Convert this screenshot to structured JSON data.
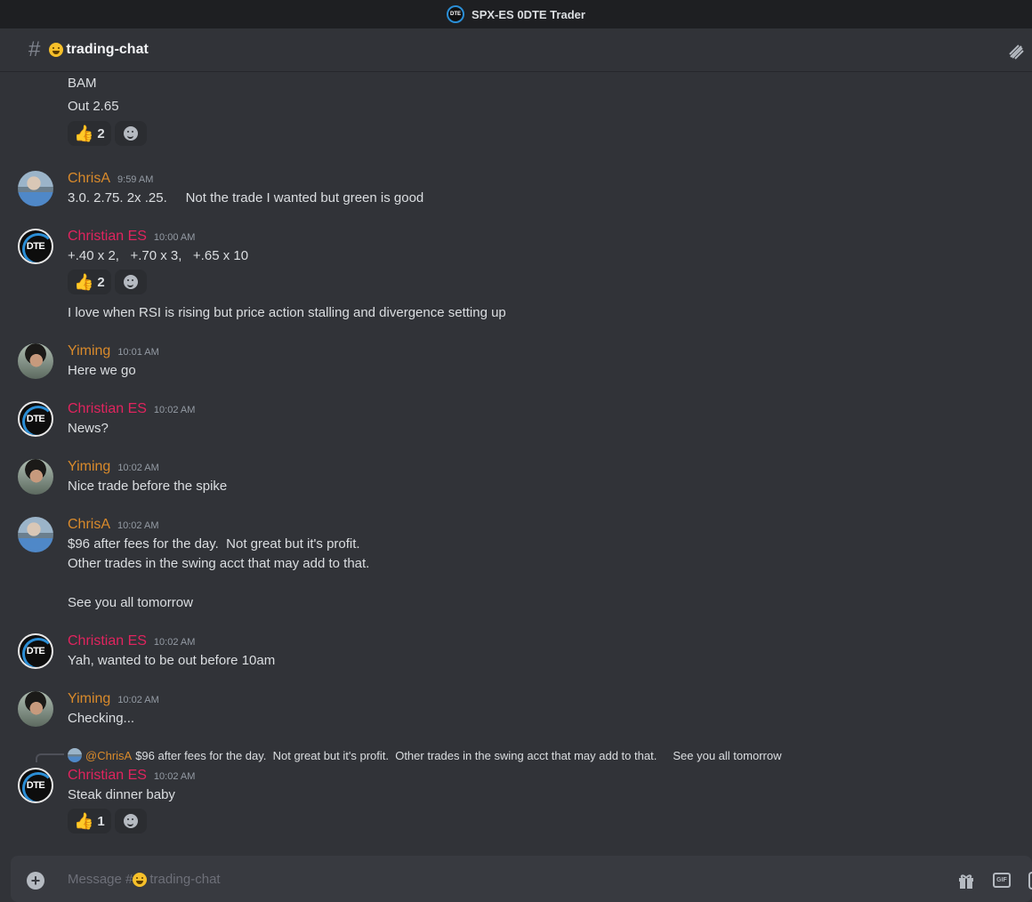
{
  "window": {
    "title": "SPX-ES 0DTE Trader",
    "logo_text": "DTE"
  },
  "channel": {
    "name": "trading-chat",
    "emoji_icon": "grinning-face-icon"
  },
  "composer": {
    "placeholder_prefix": "Message #",
    "placeholder_channel": "trading-chat",
    "gif_label": "GIF"
  },
  "messages": [
    {
      "kind": "continuation",
      "lines": [
        "BAM",
        "Out 2.65"
      ],
      "reactions": [
        {
          "emoji": "👍",
          "count": "2"
        }
      ]
    },
    {
      "author": "ChrisA",
      "time": "9:59 AM",
      "lines": [
        "3.0. 2.75. 2x .25.     Not the trade I wanted but green is good"
      ]
    },
    {
      "author": "Christian ES",
      "time": "10:00 AM",
      "lines": [
        "+.40 x 2,   +.70 x 3,   +.65 x 10"
      ],
      "reactions": [
        {
          "emoji": "👍",
          "count": "2"
        }
      ],
      "followup": "I love when RSI is rising but price action stalling and divergence setting up"
    },
    {
      "author": "Yiming",
      "time": "10:01 AM",
      "lines": [
        "Here we go"
      ]
    },
    {
      "author": "Christian ES",
      "time": "10:02 AM",
      "lines": [
        "News?"
      ]
    },
    {
      "author": "Yiming",
      "time": "10:02 AM",
      "lines": [
        "Nice trade before the spike"
      ]
    },
    {
      "author": "ChrisA",
      "time": "10:02 AM",
      "lines": [
        "$96 after fees for the day.  Not great but it's profit.",
        "Other trades in the swing acct that may add to that.",
        "",
        "See you all tomorrow"
      ]
    },
    {
      "author": "Christian ES",
      "time": "10:02 AM",
      "lines": [
        "Yah, wanted to be out before 10am"
      ]
    },
    {
      "author": "Yiming",
      "time": "10:02 AM",
      "lines": [
        "Checking..."
      ]
    },
    {
      "author": "Christian ES",
      "time": "10:02 AM",
      "reply_to": {
        "mention": "@ChrisA",
        "text": "$96 after fees for the day.  Not great but it's profit.  Other trades in the swing acct that may add to that.     See you all tomorrow"
      },
      "lines": [
        "Steak dinner baby"
      ],
      "reactions": [
        {
          "emoji": "👍",
          "count": "1"
        }
      ]
    }
  ],
  "colors": {
    "background": "#313338",
    "chris_name": "#d98a2b",
    "christian_name": "#e0245e"
  }
}
